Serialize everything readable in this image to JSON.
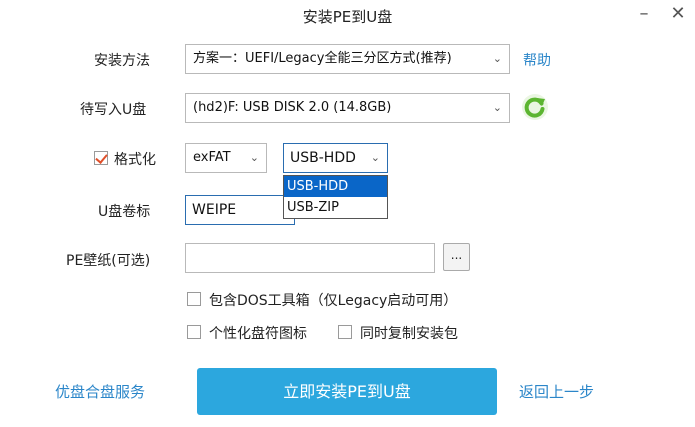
{
  "window": {
    "title": "安装PE到U盘",
    "minimize_glyph": "–",
    "close_glyph": "✕"
  },
  "install_method": {
    "label": "安装方法",
    "value": "方案一：UEFI/Legacy全能三分区方式(推荐)",
    "help_link": "帮助"
  },
  "target_disk": {
    "label": "待写入U盘",
    "value": "(hd2)F: USB DISK 2.0 (14.8GB)",
    "refresh_icon": "refresh-icon"
  },
  "format": {
    "checkbox_label": "格式化",
    "checked": true,
    "filesystem_value": "exFAT",
    "mode_value": "USB-HDD",
    "mode_options": [
      "USB-HDD",
      "USB-ZIP"
    ],
    "mode_selected_index": 0
  },
  "volume": {
    "label": "U盘卷标",
    "value": "WEIPE"
  },
  "wallpaper": {
    "label": "PE壁纸(可选)",
    "value": "",
    "browse_label": "..."
  },
  "options": {
    "dos_toolbox": {
      "label": "包含DOS工具箱（仅Legacy启动可用）",
      "checked": false
    },
    "custom_icon": {
      "label": "个性化盘符图标",
      "checked": false
    },
    "copy_package": {
      "label": "同时复制安装包",
      "checked": false
    }
  },
  "footer": {
    "service_link": "优盘合盘服务",
    "install_button": "立即安装PE到U盘",
    "back_link": "返回上一步"
  },
  "colors": {
    "accent": "#2ca7de",
    "link": "#2b86c9",
    "selection": "#0a66c8",
    "refresh": "#5cb531",
    "check": "#e0502b"
  }
}
